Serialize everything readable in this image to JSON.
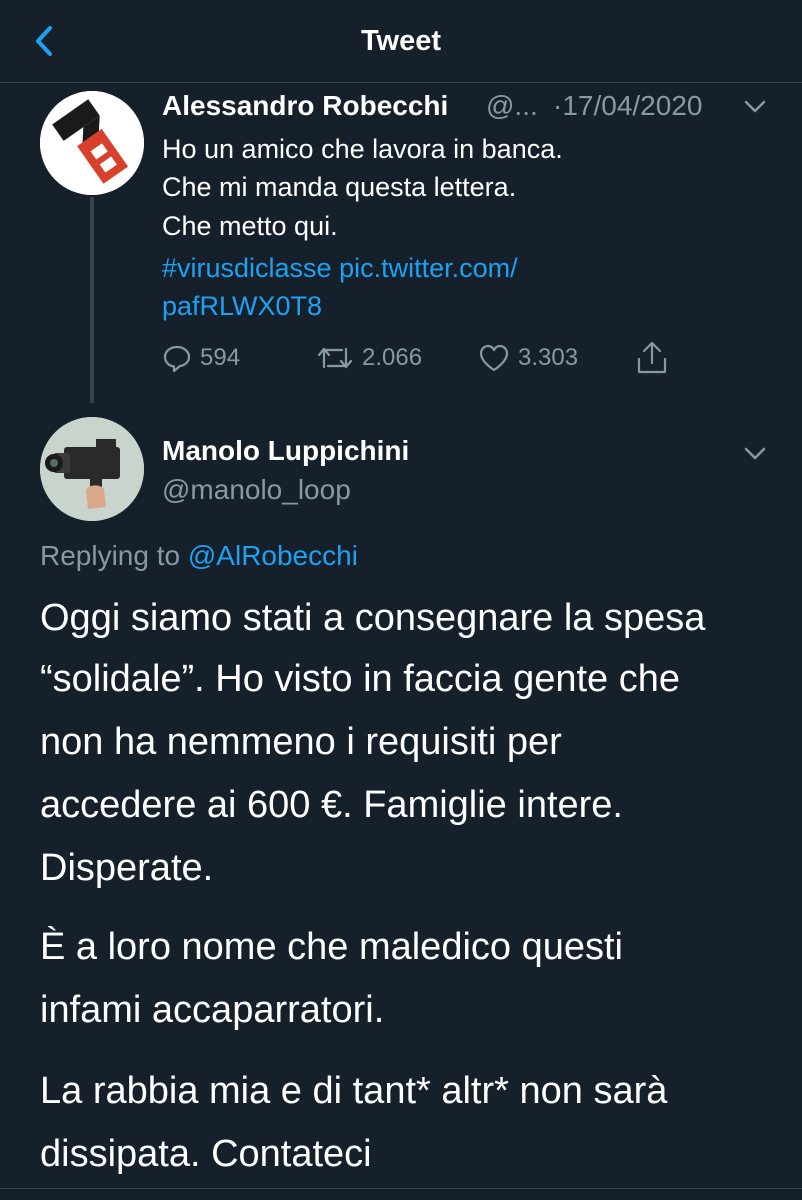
{
  "header": {
    "title": "Tweet",
    "back_icon": "chevron-left-icon"
  },
  "parent_tweet": {
    "author_name": "Alessandro Robecchi",
    "handle": "@...",
    "date": "·17/04/2020",
    "lines": [
      "Ho un amico che lavora in banca.",
      "Che mi manda questa lettera.",
      "Che metto qui."
    ],
    "hashtag": "#virusdiclasse",
    "link_part1": "pic.twitter.com/",
    "link_part2": "pafRLWX0T8",
    "replies": "594",
    "retweets": "2.066",
    "likes": "3.303"
  },
  "reply_tweet": {
    "author_name": "Manolo Luppichini",
    "handle": "@manolo_loop",
    "replying_prefix": "Replying to",
    "replying_handle": "@AlRobecchi",
    "para1_lines": [
      "Oggi siamo stati a consegnare la spesa",
      "“solidale”. Ho visto in faccia gente che",
      "non ha nemmeno i requisiti per",
      "accedere ai 600 €. Famiglie intere.",
      "Disperate."
    ],
    "para2_lines": [
      "È a loro nome che maledico questi",
      "infami accaparratori."
    ],
    "para3_lines": [
      "La rabbia mia e di tant* altr* non sarà",
      "dissipata. Contateci"
    ]
  },
  "colors": {
    "background": "#15202b",
    "accent": "#1da1f2",
    "muted": "#8899a6",
    "avatar1_red": "#d9402b"
  }
}
